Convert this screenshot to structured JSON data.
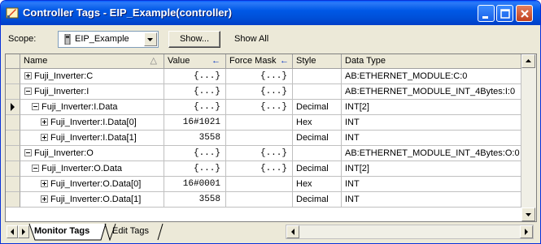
{
  "window": {
    "title": "Controller Tags - EIP_Example(controller)"
  },
  "toolbar": {
    "scope_label": "Scope:",
    "scope_value": "EIP_Example",
    "show_button": "Show...",
    "show_all": "Show All"
  },
  "columns": [
    "Name",
    "Value",
    "Force Mask",
    "Style",
    "Data Type"
  ],
  "rows": [
    {
      "name": "Fuji_Inverter:C",
      "value": "{...}",
      "force": "{...}",
      "style": "",
      "type": "AB:ETHERNET_MODULE:C:0"
    },
    {
      "name": "Fuji_Inverter:I",
      "value": "{...}",
      "force": "{...}",
      "style": "",
      "type": "AB:ETHERNET_MODULE_INT_4Bytes:I:0"
    },
    {
      "name": "Fuji_Inverter:I.Data",
      "value": "{...}",
      "force": "{...}",
      "style": "Decimal",
      "type": "INT[2]"
    },
    {
      "name": "Fuji_Inverter:I.Data[0]",
      "value": "16#1021",
      "force": "",
      "style": "Hex",
      "type": "INT"
    },
    {
      "name": "Fuji_Inverter:I.Data[1]",
      "value": "3558",
      "force": "",
      "style": "Decimal",
      "type": "INT"
    },
    {
      "name": "Fuji_Inverter:O",
      "value": "{...}",
      "force": "{...}",
      "style": "",
      "type": "AB:ETHERNET_MODULE_INT_4Bytes:O:0"
    },
    {
      "name": "Fuji_Inverter:O.Data",
      "value": "{...}",
      "force": "{...}",
      "style": "Decimal",
      "type": "INT[2]"
    },
    {
      "name": "Fuji_Inverter:O.Data[0]",
      "value": "16#0001",
      "force": "",
      "style": "Hex",
      "type": "INT"
    },
    {
      "name": "Fuji_Inverter:O.Data[1]",
      "value": "3558",
      "force": "",
      "style": "Decimal",
      "type": "INT"
    }
  ],
  "tabs": {
    "monitor": "Monitor Tags",
    "edit": "Edit Tags"
  },
  "icons": {
    "title_icon": "controller-tags-icon",
    "scope_icon": "controller-icon",
    "minimize": "minimize-icon",
    "maximize": "maximize-icon",
    "close": "close-icon"
  },
  "colors": {
    "titlebar": "#0054e3",
    "window_bg": "#ece9d8",
    "close_button": "#d0502c"
  }
}
